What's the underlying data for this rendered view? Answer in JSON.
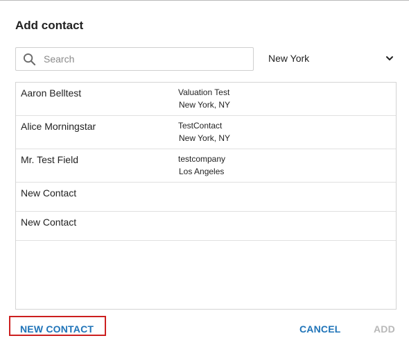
{
  "dialog": {
    "title": "Add contact"
  },
  "search": {
    "placeholder": "Search",
    "value": ""
  },
  "location_filter": {
    "selected": "New York"
  },
  "contacts": [
    {
      "name": "Aaron Belltest",
      "company": "Valuation Test",
      "location": "New York, NY"
    },
    {
      "name": "Alice Morningstar",
      "company": "TestContact",
      "location": "New York, NY"
    },
    {
      "name": "Mr. Test Field",
      "company": "testcompany",
      "location": "Los Angeles"
    },
    {
      "name": "New Contact",
      "company": "",
      "location": ""
    },
    {
      "name": "New Contact",
      "company": "",
      "location": ""
    }
  ],
  "footer": {
    "new_contact_label": "NEW CONTACT",
    "cancel_label": "CANCEL",
    "add_label": "ADD"
  },
  "colors": {
    "accent": "#1e73b8",
    "disabled": "#b8b8b8",
    "highlight": "#cc1f1f"
  }
}
